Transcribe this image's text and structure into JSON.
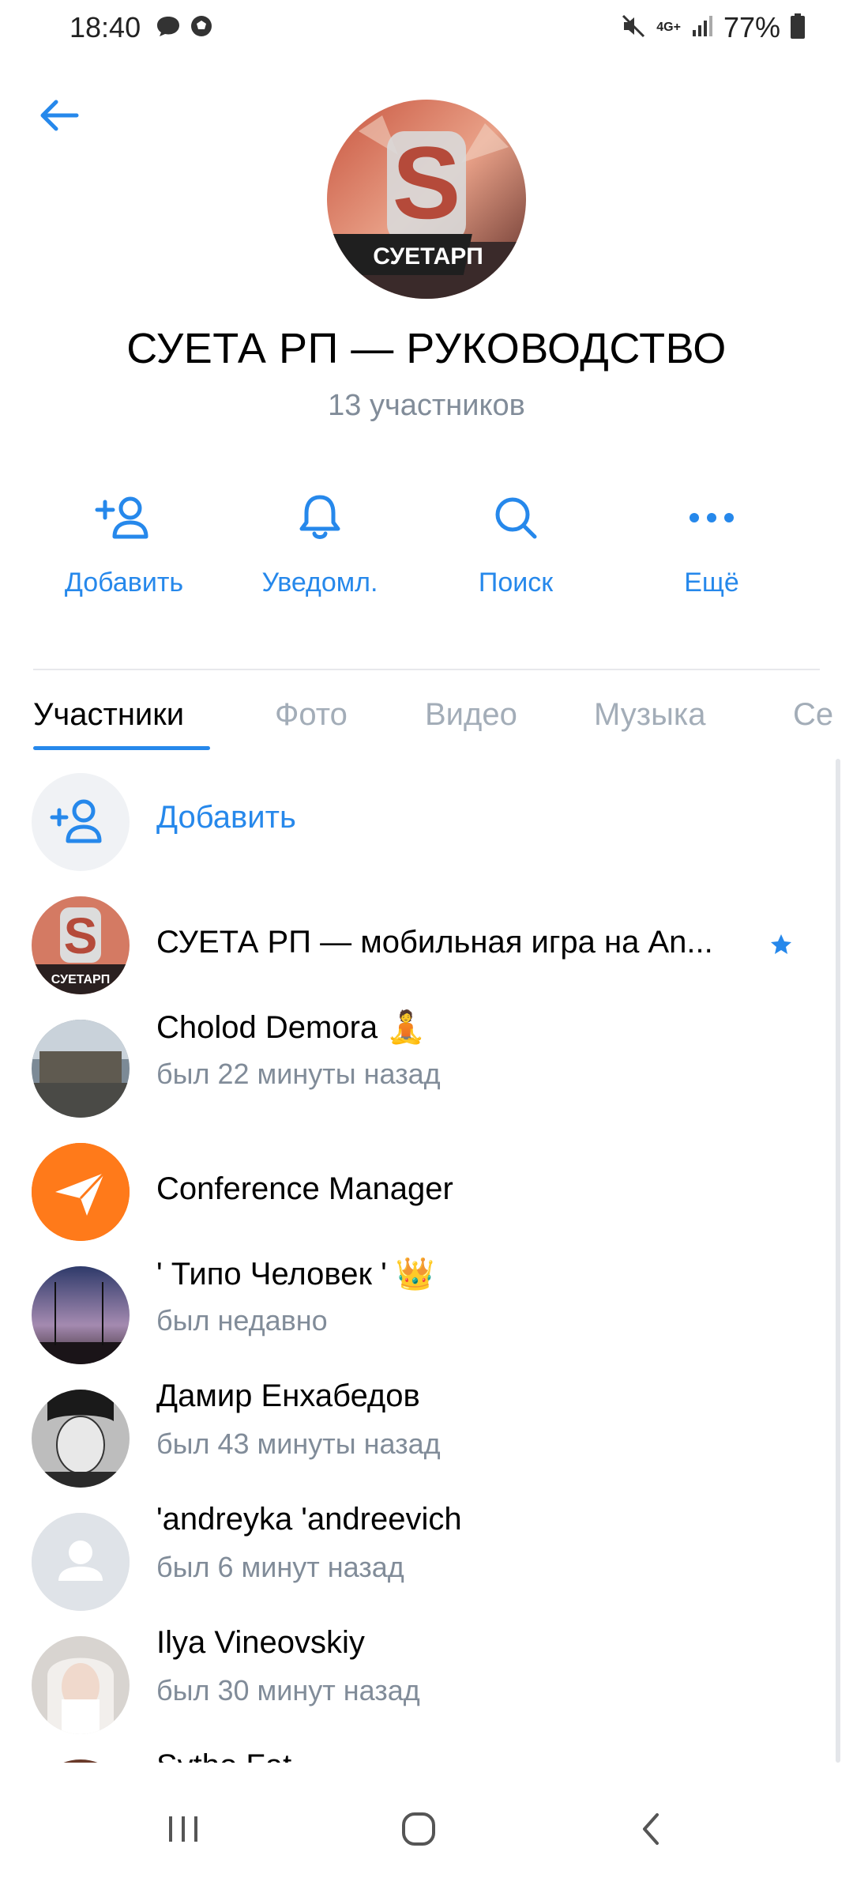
{
  "status_bar": {
    "time": "18:40",
    "battery": "77%",
    "network": "4G+",
    "icons": [
      "message-icon",
      "soccer-icon",
      "mute-icon",
      "signal-icon",
      "battery-icon"
    ]
  },
  "header": {
    "back_icon": "arrow-left-icon",
    "avatar_text": "СУЕТАРП",
    "title": "СУЕТА РП — РУКОВОДСТВО",
    "subtitle": "13 участников"
  },
  "actions": [
    {
      "label": "Добавить",
      "icon": "add-user-icon"
    },
    {
      "label": "Уведомл.",
      "icon": "bell-icon"
    },
    {
      "label": "Поиск",
      "icon": "search-icon"
    },
    {
      "label": "Ещё",
      "icon": "more-icon"
    }
  ],
  "tabs": [
    "Участники",
    "Фото",
    "Видео",
    "Музыка",
    "Се"
  ],
  "active_tab": "Участники",
  "members": {
    "add_label": "Добавить",
    "items": [
      {
        "name": "СУЕТА РП — мобильная игра на An...",
        "status": "",
        "badge": "star-icon",
        "avatar_text": "СУЕТАРП"
      },
      {
        "name": "Cholod Demora 🧘",
        "status": "был 22 минуты назад"
      },
      {
        "name": "Conference Manager",
        "status": ""
      },
      {
        "name": "' Типо Человек ' 👑",
        "status": "был недавно"
      },
      {
        "name": "Дамир Енхабедов",
        "status": "был 43 минуты назад"
      },
      {
        "name": "'andreyka 'andreevich",
        "status": "был 6 минут назад"
      },
      {
        "name": "Ilya Vineovskiy",
        "status": "был 30 минут назад"
      },
      {
        "name": "Sytho Fat...",
        "status": ""
      }
    ]
  },
  "colors": {
    "accent": "#2688eb",
    "secondary_text": "#818c99",
    "tab_inactive": "#a3adb8",
    "divider": "#e7e8ec"
  }
}
